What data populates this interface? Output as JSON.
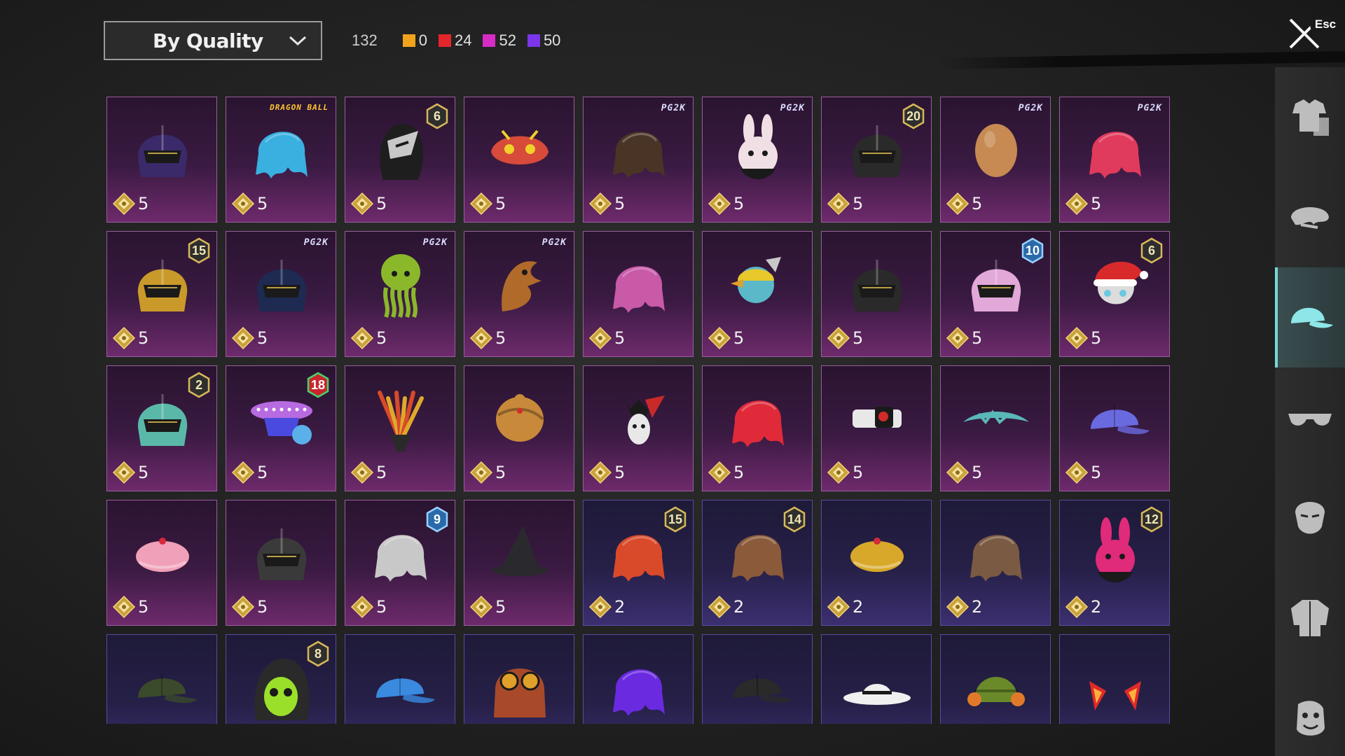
{
  "toolbar": {
    "sort_label": "By Quality",
    "total_count": "132",
    "quality_counts": [
      {
        "name": "legendary",
        "color": "#f2a31c",
        "count": "0"
      },
      {
        "name": "mythic",
        "color": "#e3262b",
        "count": "24"
      },
      {
        "name": "epic-plus",
        "color": "#d62cc4",
        "count": "52"
      },
      {
        "name": "epic",
        "color": "#7a36e8",
        "count": "50"
      }
    ]
  },
  "close": {
    "esc_label": "Esc"
  },
  "items": [
    {
      "name": "tile-dark-visor-helmet",
      "quality": "mythic",
      "icon": "helmet-icon",
      "color": "#3a2a6a",
      "cost": "5",
      "badge": null
    },
    {
      "name": "tile-blue-spiky-hair",
      "quality": "mythic",
      "icon": "hair-icon",
      "color": "#3ab0e0",
      "cost": "5",
      "badge": null,
      "brand": "DRAGON BALL"
    },
    {
      "name": "tile-silver-winged-mask",
      "quality": "mythic",
      "icon": "mask-icon",
      "color": "#c8c8c8",
      "cost": "5",
      "badge": {
        "value": "6",
        "kind": "gold"
      }
    },
    {
      "name": "tile-dragon-mask",
      "quality": "mythic",
      "icon": "dragon-mask-icon",
      "color": "#d84a3a",
      "cost": "5",
      "badge": null
    },
    {
      "name": "tile-brown-long-hair",
      "quality": "mythic",
      "icon": "hair-icon",
      "color": "#4a3426",
      "cost": "5",
      "badge": null,
      "brand": "PG2K"
    },
    {
      "name": "tile-bunny-mask",
      "quality": "mythic",
      "icon": "bunny-icon",
      "color": "#f0e0e6",
      "cost": "5",
      "badge": null,
      "brand": "PG2K"
    },
    {
      "name": "tile-gold-trim-helmet",
      "quality": "mythic",
      "icon": "helmet-icon",
      "color": "#2a2a2a",
      "cost": "5",
      "badge": {
        "value": "20",
        "kind": "gold"
      }
    },
    {
      "name": "tile-bald-head",
      "quality": "mythic",
      "icon": "head-icon",
      "color": "#c68a52",
      "cost": "5",
      "badge": null,
      "brand": "PG2K"
    },
    {
      "name": "tile-red-bob-hair",
      "quality": "mythic",
      "icon": "hair-icon",
      "color": "#e03a5c",
      "cost": "5",
      "badge": null,
      "brand": "PG2K"
    },
    {
      "name": "tile-gold-robot-helmet",
      "quality": "mythic",
      "icon": "helmet-icon",
      "color": "#c99a2a",
      "cost": "5",
      "badge": {
        "value": "15",
        "kind": "gold"
      }
    },
    {
      "name": "tile-navy-gold-helmet",
      "quality": "mythic",
      "icon": "helmet-icon",
      "color": "#1e2a52",
      "cost": "5",
      "badge": null,
      "brand": "PG2K"
    },
    {
      "name": "tile-green-octopus-mask",
      "quality": "mythic",
      "icon": "octopus-icon",
      "color": "#8ab82a",
      "cost": "5",
      "badge": null,
      "brand": "PG2K"
    },
    {
      "name": "tile-bronze-bird-mask",
      "quality": "mythic",
      "icon": "bird-icon",
      "color": "#b06a2a",
      "cost": "5",
      "badge": null,
      "brand": "PG2K"
    },
    {
      "name": "tile-pink-pigtail-hair",
      "quality": "mythic",
      "icon": "hair-icon",
      "color": "#c85aa8",
      "cost": "5",
      "badge": null
    },
    {
      "name": "tile-yellow-duck-helmet",
      "quality": "mythic",
      "icon": "duck-icon",
      "color": "#e8c82a",
      "cost": "5",
      "badge": null
    },
    {
      "name": "tile-dark-spike-helmet",
      "quality": "mythic",
      "icon": "helmet-icon",
      "color": "#2a2a2a",
      "cost": "5",
      "badge": null
    },
    {
      "name": "tile-pink-goggle-helmet",
      "quality": "mythic",
      "icon": "helmet-icon",
      "color": "#e2a8d8",
      "cost": "5",
      "badge": {
        "value": "10",
        "kind": "blue"
      }
    },
    {
      "name": "tile-santa-hat-mask",
      "quality": "mythic",
      "icon": "santa-icon",
      "color": "#d82a2a",
      "cost": "5",
      "badge": {
        "value": "6",
        "kind": "gold"
      }
    },
    {
      "name": "tile-teal-knight-helmet",
      "quality": "mythic",
      "icon": "helmet-icon",
      "color": "#5ab8a8",
      "cost": "5",
      "badge": {
        "value": "2",
        "kind": "gold"
      }
    },
    {
      "name": "tile-purple-ufo-hat",
      "quality": "mythic",
      "icon": "ufo-icon",
      "color": "#b86ae0",
      "cost": "5",
      "badge": {
        "value": "18",
        "kind": "red"
      }
    },
    {
      "name": "tile-feather-headdress",
      "quality": "mythic",
      "icon": "feather-icon",
      "color": "#d84a2a",
      "cost": "5",
      "badge": null
    },
    {
      "name": "tile-gold-turban",
      "quality": "mythic",
      "icon": "turban-icon",
      "color": "#c88a3a",
      "cost": "5",
      "badge": null
    },
    {
      "name": "tile-jester-mask",
      "quality": "mythic",
      "icon": "jester-icon",
      "color": "#c82a2a",
      "cost": "5",
      "badge": null
    },
    {
      "name": "tile-red-hair-cap",
      "quality": "mythic",
      "icon": "hair-icon",
      "color": "#e02a3a",
      "cost": "5",
      "badge": null
    },
    {
      "name": "tile-tech-visor",
      "quality": "mythic",
      "icon": "visor-icon",
      "color": "#e8e8e8",
      "cost": "5",
      "badge": null
    },
    {
      "name": "tile-teal-tiara",
      "quality": "mythic",
      "icon": "tiara-icon",
      "color": "#5ab8b8",
      "cost": "5",
      "badge": null
    },
    {
      "name": "tile-galaxy-cap",
      "quality": "mythic",
      "icon": "cap-icon",
      "color": "#6a6ae0",
      "cost": "5",
      "badge": null
    },
    {
      "name": "tile-strawberry-beret",
      "quality": "mythic",
      "icon": "beret-icon",
      "color": "#f0a0b8",
      "cost": "5",
      "badge": null
    },
    {
      "name": "tile-red-plume-helmet",
      "quality": "mythic",
      "icon": "helmet-icon",
      "color": "#3a3a3a",
      "cost": "5",
      "badge": null
    },
    {
      "name": "tile-silver-dreadlocks",
      "quality": "mythic",
      "icon": "hair-icon",
      "color": "#c8c8c8",
      "cost": "5",
      "badge": {
        "value": "9",
        "kind": "blue"
      }
    },
    {
      "name": "tile-black-wizard-hat",
      "quality": "mythic",
      "icon": "wizard-hat-icon",
      "color": "#2a2a2e",
      "cost": "5",
      "badge": null
    },
    {
      "name": "tile-pumpkin-hair",
      "quality": "epic",
      "icon": "hair-icon",
      "color": "#d84a2a",
      "cost": "2",
      "badge": {
        "value": "15",
        "kind": "gold"
      }
    },
    {
      "name": "tile-cat-ear-long-hair",
      "quality": "epic",
      "icon": "hair-icon",
      "color": "#8a5a3a",
      "cost": "2",
      "badge": {
        "value": "14",
        "kind": "gold"
      }
    },
    {
      "name": "tile-yellow-beret-hair",
      "quality": "epic",
      "icon": "beret-icon",
      "color": "#d8a82a",
      "cost": "2",
      "badge": null
    },
    {
      "name": "tile-brown-bob-hair",
      "quality": "epic",
      "icon": "hair-icon",
      "color": "#7a5a42",
      "cost": "2",
      "badge": null
    },
    {
      "name": "tile-bunny-ear-helmet",
      "quality": "epic",
      "icon": "bunny-icon",
      "color": "#e02a7a",
      "cost": "2",
      "badge": {
        "value": "12",
        "kind": "gold"
      }
    },
    {
      "name": "tile-military-cap",
      "quality": "epic",
      "icon": "cap-icon",
      "color": "#3a4a2a",
      "cost": "",
      "badge": null
    },
    {
      "name": "tile-skull-hood",
      "quality": "epic",
      "icon": "hood-icon",
      "color": "#9ae02a",
      "cost": "",
      "badge": {
        "value": "8",
        "kind": "gold"
      }
    },
    {
      "name": "tile-blue-baseball-cap",
      "quality": "epic",
      "icon": "cap-icon",
      "color": "#3a8ae0",
      "cost": "",
      "badge": null
    },
    {
      "name": "tile-goggles-hair",
      "quality": "epic",
      "icon": "goggles-icon",
      "color": "#a84a2a",
      "cost": "",
      "badge": null
    },
    {
      "name": "tile-purple-headband-hair",
      "quality": "epic",
      "icon": "hair-icon",
      "color": "#6a2ae0",
      "cost": "",
      "badge": null
    },
    {
      "name": "tile-black-cap",
      "quality": "epic",
      "icon": "cap-icon",
      "color": "#2a2a2a",
      "cost": "",
      "badge": null
    },
    {
      "name": "tile-white-sun-hat",
      "quality": "epic",
      "icon": "sun-hat-icon",
      "color": "#f0f0f0",
      "cost": "",
      "badge": null
    },
    {
      "name": "tile-green-beanie-headphones",
      "quality": "epic",
      "icon": "beanie-icon",
      "color": "#6a8a2a",
      "cost": "",
      "badge": null
    },
    {
      "name": "tile-red-horn-ears",
      "quality": "epic",
      "icon": "horn-icon",
      "color": "#e02a2a",
      "cost": "",
      "badge": null
    }
  ],
  "sidebar": [
    {
      "name": "side-tab-outfit",
      "icon": "outfit-icon",
      "active": false
    },
    {
      "name": "side-tab-mask",
      "icon": "mask-icon",
      "active": false
    },
    {
      "name": "side-tab-headwear",
      "icon": "cap-icon",
      "active": true
    },
    {
      "name": "side-tab-eyewear",
      "icon": "glasses-icon",
      "active": false
    },
    {
      "name": "side-tab-face",
      "icon": "face-icon",
      "active": false
    },
    {
      "name": "side-tab-jacket",
      "icon": "jacket-icon",
      "active": false
    },
    {
      "name": "side-tab-emote",
      "icon": "emote-icon",
      "active": false
    }
  ]
}
